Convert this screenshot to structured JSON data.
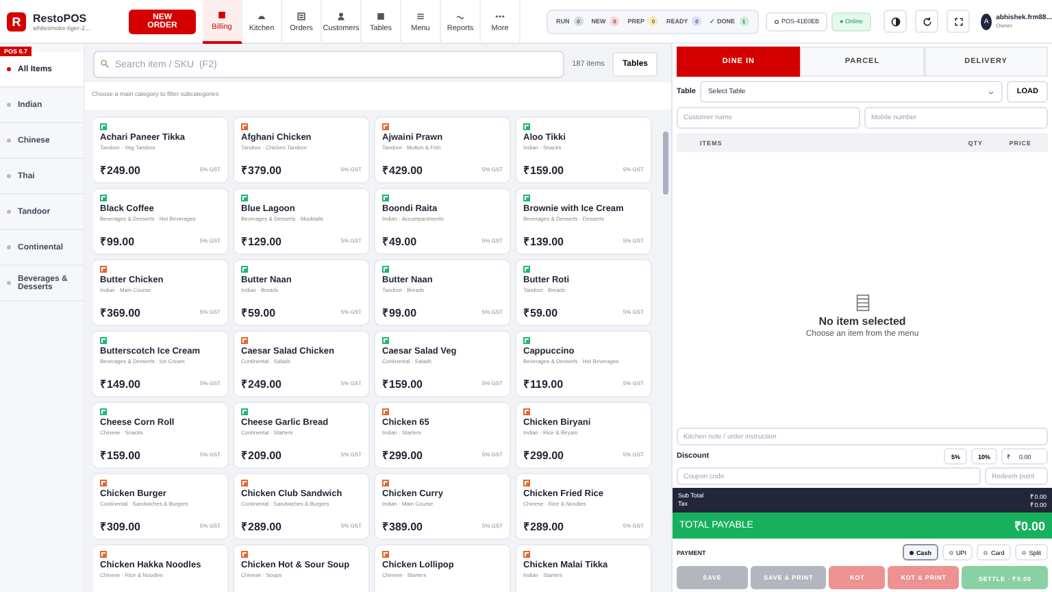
{
  "header": {
    "logo": "R",
    "brand": "RestoPOS",
    "subtitle": "whitesmoke-tiger-2...",
    "new_order": "NEW ORDER",
    "nav": [
      {
        "label": "Billing",
        "selected": true
      },
      {
        "label": "Kitchen",
        "selected": false
      },
      {
        "label": "Orders",
        "selected": false
      },
      {
        "label": "Customers",
        "selected": false
      },
      {
        "label": "Tables",
        "selected": false
      },
      {
        "label": "Menu",
        "selected": false
      },
      {
        "label": "Reports",
        "selected": false
      },
      {
        "label": "More",
        "selected": false
      }
    ],
    "status": [
      {
        "label": "RUN",
        "count": "0",
        "color": "#d8dae3"
      },
      {
        "label": "NEW",
        "count": "0",
        "color": "#fcd5d5"
      },
      {
        "label": "PREP",
        "count": "0",
        "color": "#fbe9b0"
      },
      {
        "label": "READY",
        "count": "0",
        "color": "#d9dcfb"
      },
      {
        "label": "✓ DONE",
        "count": "1",
        "color": "#c9f0d8"
      }
    ],
    "terminal": "POS-41E0EB",
    "connection": "● Online",
    "user": {
      "initial": "A",
      "name": "abhishek.frm88...",
      "role": "Owner"
    }
  },
  "version": "POS 6.7",
  "categories": [
    {
      "label": "All Items",
      "selected": true
    },
    {
      "label": "Indian",
      "selected": false
    },
    {
      "label": "Chinese",
      "selected": false
    },
    {
      "label": "Thai",
      "selected": false
    },
    {
      "label": "Tandoor",
      "selected": false
    },
    {
      "label": "Continental",
      "selected": false
    },
    {
      "label": "Beverages & Desserts",
      "selected": false
    }
  ],
  "search": {
    "placeholder": "Search item / SKU  (F2)"
  },
  "item_count": "187 items",
  "tables_button": "Tables",
  "hint": "Choose a main category to filter subcategories",
  "items": [
    {
      "name": "Achari Paneer Tikka",
      "category": "Tandoor · Veg Tandoor",
      "price": "₹249.00",
      "tax": "5% GST",
      "veg": true
    },
    {
      "name": "Afghani Chicken",
      "category": "Tandoor · Chicken Tandoor",
      "price": "₹379.00",
      "tax": "5% GST",
      "veg": false
    },
    {
      "name": "Ajwaini Prawn",
      "category": "Tandoor · Mutton & Fish",
      "price": "₹429.00",
      "tax": "5% GST",
      "veg": false
    },
    {
      "name": "Aloo Tikki",
      "category": "Indian · Snacks",
      "price": "₹159.00",
      "tax": "5% GST",
      "veg": true
    },
    {
      "name": "Black Coffee",
      "category": "Beverages & Desserts · Hot Beverages",
      "price": "₹99.00",
      "tax": "5% GST",
      "veg": true
    },
    {
      "name": "Blue Lagoon",
      "category": "Beverages & Desserts · Mocktails",
      "price": "₹129.00",
      "tax": "5% GST",
      "veg": true
    },
    {
      "name": "Boondi Raita",
      "category": "Indian · Accompaniments",
      "price": "₹49.00",
      "tax": "5% GST",
      "veg": true
    },
    {
      "name": "Brownie with Ice Cream",
      "category": "Beverages & Desserts · Desserts",
      "price": "₹139.00",
      "tax": "5% GST",
      "veg": true
    },
    {
      "name": "Butter Chicken",
      "category": "Indian · Main Course",
      "price": "₹369.00",
      "tax": "5% GST",
      "veg": false
    },
    {
      "name": "Butter Naan",
      "category": "Indian · Breads",
      "price": "₹59.00",
      "tax": "5% GST",
      "veg": true
    },
    {
      "name": "Butter Naan",
      "category": "Tandoor · Breads",
      "price": "₹99.00",
      "tax": "5% GST",
      "veg": true
    },
    {
      "name": "Butter Roti",
      "category": "Tandoor · Breads",
      "price": "₹59.00",
      "tax": "5% GST",
      "veg": true
    },
    {
      "name": "Butterscotch Ice Cream",
      "category": "Beverages & Desserts · Ice Cream",
      "price": "₹149.00",
      "tax": "5% GST",
      "veg": true
    },
    {
      "name": "Caesar Salad Chicken",
      "category": "Continental · Salads",
      "price": "₹249.00",
      "tax": "5% GST",
      "veg": false
    },
    {
      "name": "Caesar Salad Veg",
      "category": "Continental · Salads",
      "price": "₹159.00",
      "tax": "5% GST",
      "veg": true
    },
    {
      "name": "Cappuccino",
      "category": "Beverages & Desserts · Hot Beverages",
      "price": "₹119.00",
      "tax": "5% GST",
      "veg": true
    },
    {
      "name": "Cheese Corn Roll",
      "category": "Chinese · Snacks",
      "price": "₹159.00",
      "tax": "5% GST",
      "veg": true
    },
    {
      "name": "Cheese Garlic Bread",
      "category": "Continental · Starters",
      "price": "₹209.00",
      "tax": "5% GST",
      "veg": true
    },
    {
      "name": "Chicken 65",
      "category": "Indian · Starters",
      "price": "₹299.00",
      "tax": "5% GST",
      "veg": false
    },
    {
      "name": "Chicken Biryani",
      "category": "Indian · Rice & Biryani",
      "price": "₹299.00",
      "tax": "5% GST",
      "veg": false
    },
    {
      "name": "Chicken Burger",
      "category": "Continental · Sandwiches & Burgers",
      "price": "₹309.00",
      "tax": "5% GST",
      "veg": false
    },
    {
      "name": "Chicken Club Sandwich",
      "category": "Continental · Sandwiches & Burgers",
      "price": "₹289.00",
      "tax": "5% GST",
      "veg": false
    },
    {
      "name": "Chicken Curry",
      "category": "Indian · Main Course",
      "price": "₹389.00",
      "tax": "5% GST",
      "veg": false
    },
    {
      "name": "Chicken Fried Rice",
      "category": "Chinese · Rice & Noodles",
      "price": "₹289.00",
      "tax": "5% GST",
      "veg": false
    },
    {
      "name": "Chicken Hakka Noodles",
      "category": "Chinese · Rice & Noodles",
      "veg": false
    },
    {
      "name": "Chicken Hot & Sour Soup",
      "category": "Chinese · Soups",
      "veg": false
    },
    {
      "name": "Chicken Lollipop",
      "category": "Chinese · Starters",
      "veg": false
    },
    {
      "name": "Chicken Malai Tikka",
      "category": "Indian · Starters",
      "veg": false
    }
  ],
  "order": {
    "types": [
      {
        "label": "DINE IN",
        "selected": true
      },
      {
        "label": "PARCEL",
        "selected": false
      },
      {
        "label": "DELIVERY",
        "selected": false
      }
    ],
    "table_label": "Table",
    "table_select": "Select Table",
    "load": "LOAD",
    "customer": {
      "placeholder": "Customer name"
    },
    "mobile": {
      "placeholder": "Mobile number"
    },
    "columns": [
      "ITEMS",
      "QTY",
      "PRICE"
    ],
    "empty_title": "No item selected",
    "empty_text": "Choose an item from the menu",
    "note": {
      "placeholder": "Kitchen note / order instruction"
    },
    "discount_label": "Discount",
    "discount_options": [
      "5%",
      "10%"
    ],
    "discount_currency": "₹",
    "discount_value": "0.00",
    "coupon": {
      "placeholder": "Coupon code"
    },
    "redeem": {
      "placeholder": "Redeem point"
    },
    "subtotal_label": "Sub Total",
    "subtotal": "₹0.00",
    "tax_label": "Tax",
    "tax": "₹0.00",
    "total_label": "TOTAL PAYABLE",
    "total": "₹0.00",
    "payment_label": "PAYMENT",
    "payments": [
      {
        "label": "Cash",
        "selected": true
      },
      {
        "label": "UPI",
        "selected": false
      },
      {
        "label": "Card",
        "selected": false
      },
      {
        "label": "Split",
        "selected": false
      }
    ],
    "actions": [
      {
        "label": "SAVE",
        "kind": "neutral",
        "disabled": true
      },
      {
        "label": "SAVE & PRINT",
        "kind": "neutral",
        "disabled": true
      },
      {
        "label": "KOT",
        "kind": "danger",
        "disabled": true
      },
      {
        "label": "KOT & PRINT",
        "kind": "danger",
        "disabled": true
      },
      {
        "label": "SETTLE · ₹0.00",
        "kind": "success",
        "disabled": true
      }
    ]
  }
}
